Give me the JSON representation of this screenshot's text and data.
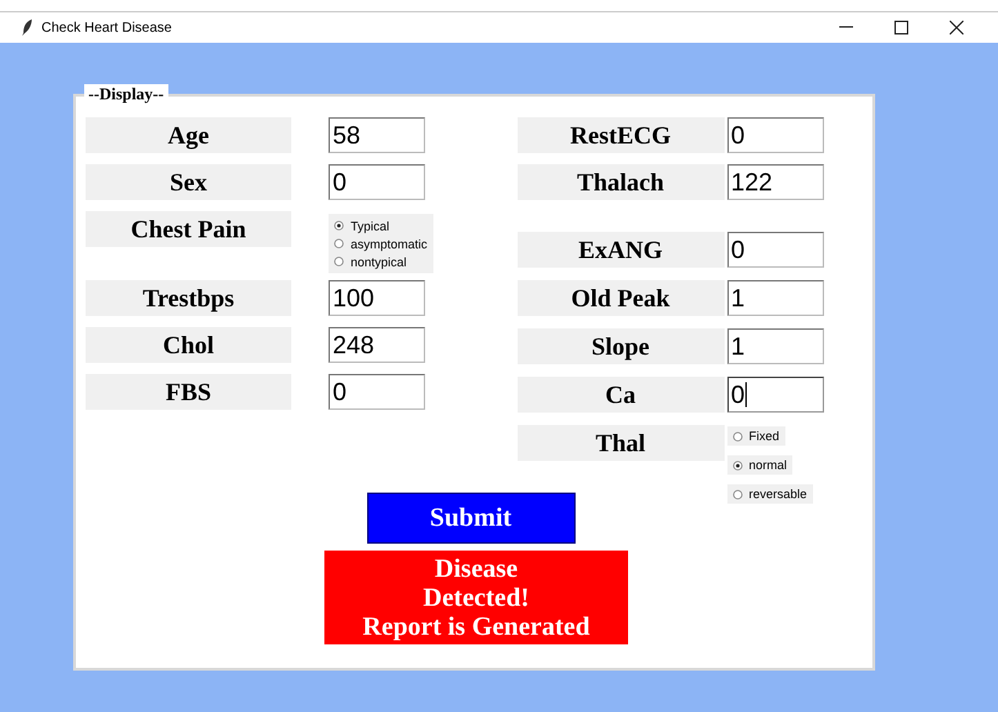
{
  "window": {
    "title": "Check Heart Disease"
  },
  "frame": {
    "label": "--Display--"
  },
  "left_fields": [
    {
      "label": "Age",
      "kind": "entry",
      "value": "58",
      "focused": false
    },
    {
      "label": "Sex",
      "kind": "entry",
      "value": "0",
      "focused": false
    },
    {
      "label": "Chest Pain",
      "kind": "radio",
      "options": [
        {
          "label": "Typical",
          "selected": true
        },
        {
          "label": "asymptomatic",
          "selected": false
        },
        {
          "label": "nontypical",
          "selected": false
        }
      ]
    },
    {
      "label": "Trestbps",
      "kind": "entry",
      "value": "100",
      "focused": false
    },
    {
      "label": "Chol",
      "kind": "entry",
      "value": "248",
      "focused": false
    },
    {
      "label": "FBS",
      "kind": "entry",
      "value": "0",
      "focused": false
    }
  ],
  "right_fields": [
    {
      "label": "RestECG",
      "kind": "entry",
      "value": "0",
      "focused": false
    },
    {
      "label": "Thalach",
      "kind": "entry",
      "value": "122",
      "focused": false
    },
    {
      "label": "ExANG",
      "kind": "entry",
      "value": "0",
      "focused": false
    },
    {
      "label": "Old Peak",
      "kind": "entry",
      "value": "1",
      "focused": false
    },
    {
      "label": "Slope",
      "kind": "entry",
      "value": "1",
      "focused": false
    },
    {
      "label": "Ca",
      "kind": "entry",
      "value": "0",
      "focused": true
    },
    {
      "label": "Thal",
      "kind": "radio_stack",
      "options": [
        {
          "label": "Fixed",
          "selected": false
        },
        {
          "label": "normal",
          "selected": true
        },
        {
          "label": "reversable",
          "selected": false
        }
      ]
    }
  ],
  "submit": {
    "label": "Submit"
  },
  "result": {
    "lines": [
      "Disease",
      "Detected!",
      "Report is Generated"
    ]
  }
}
